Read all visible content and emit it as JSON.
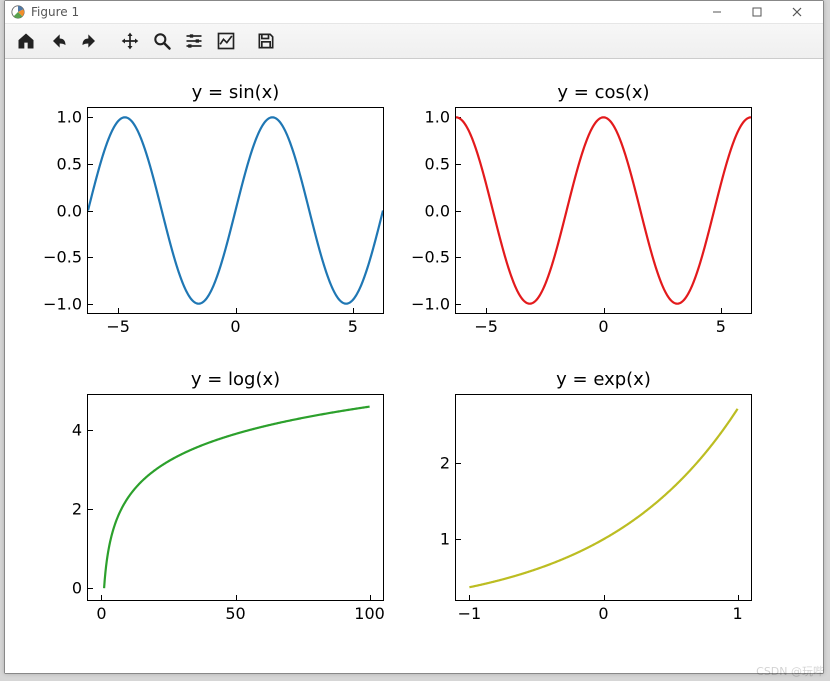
{
  "window": {
    "title": "Figure 1",
    "buttons": {
      "minimize": "—",
      "maximize": "▢",
      "close": "✕"
    }
  },
  "toolbar": {
    "items": [
      {
        "name": "home-icon"
      },
      {
        "name": "back-icon"
      },
      {
        "name": "forward-icon"
      },
      {
        "name": "pan-icon"
      },
      {
        "name": "zoom-icon"
      },
      {
        "name": "configure-subplots-icon"
      },
      {
        "name": "edit-axis-icon"
      },
      {
        "name": "save-icon"
      }
    ]
  },
  "watermark": "CSDN @玩哔",
  "chart_data": [
    {
      "type": "line",
      "title": "y = sin(x)",
      "xlabel": "",
      "ylabel": "",
      "xlim": [
        -6.283,
        6.283
      ],
      "ylim": [
        -1.1,
        1.1
      ],
      "xticks": [
        -5,
        0,
        5
      ],
      "yticks": [
        -1.0,
        -0.5,
        0.0,
        0.5,
        1.0
      ],
      "color": "#1f77b4",
      "function": "sin",
      "series": [
        {
          "name": "sin(x)",
          "x_range": [
            -6.283,
            6.283
          ],
          "fn": "Math.sin(x)"
        }
      ]
    },
    {
      "type": "line",
      "title": "y = cos(x)",
      "xlabel": "",
      "ylabel": "",
      "xlim": [
        -6.283,
        6.283
      ],
      "ylim": [
        -1.1,
        1.1
      ],
      "xticks": [
        -5,
        0,
        5
      ],
      "yticks": [
        -1.0,
        -0.5,
        0.0,
        0.5,
        1.0
      ],
      "color": "#e31a1c",
      "function": "cos",
      "series": [
        {
          "name": "cos(x)",
          "x_range": [
            -6.283,
            6.283
          ],
          "fn": "Math.cos(x)"
        }
      ]
    },
    {
      "type": "line",
      "title": "y = log(x)",
      "xlabel": "",
      "ylabel": "",
      "xlim": [
        -5,
        105
      ],
      "ylim": [
        -0.3,
        4.9
      ],
      "xticks": [
        0,
        50,
        100
      ],
      "yticks": [
        0,
        2,
        4
      ],
      "color": "#2ca02c",
      "function": "log",
      "series": [
        {
          "name": "log(x)",
          "x_range": [
            1,
            100
          ],
          "fn": "Math.log(x)"
        }
      ]
    },
    {
      "type": "line",
      "title": "y = exp(x)",
      "xlabel": "",
      "ylabel": "",
      "xlim": [
        -1.1,
        1.1
      ],
      "ylim": [
        0.2,
        2.9
      ],
      "xticks": [
        -1,
        0,
        1
      ],
      "yticks": [
        1,
        2
      ],
      "color": "#bcbd22",
      "function": "exp",
      "series": [
        {
          "name": "exp(x)",
          "x_range": [
            -1,
            1
          ],
          "fn": "Math.exp(x)"
        }
      ]
    }
  ]
}
